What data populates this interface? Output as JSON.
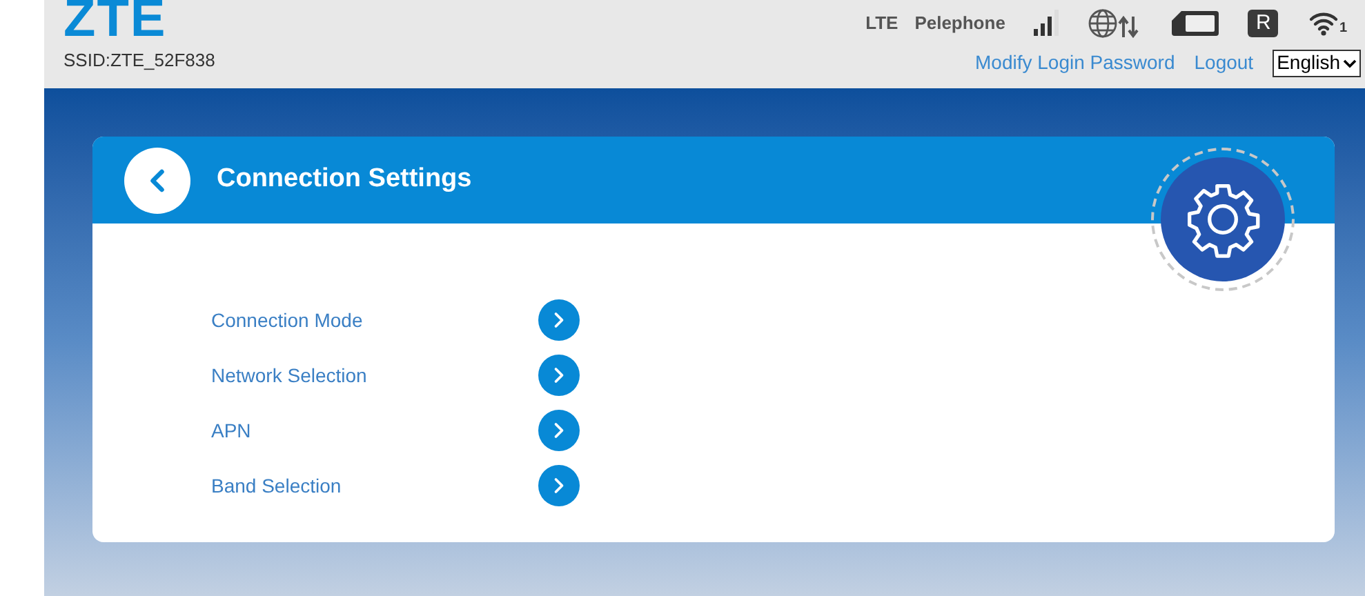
{
  "header": {
    "logo": "ZTE",
    "ssid": "SSID:ZTE_52F838",
    "network_type": "LTE",
    "operator": "Pelephone",
    "roaming": "R",
    "wifi_clients": "1",
    "links": [
      "Modify Login Password",
      "Logout"
    ],
    "language": "English"
  },
  "panel": {
    "title": "Connection Settings",
    "items": [
      {
        "label": "Connection Mode"
      },
      {
        "label": "Network Selection"
      },
      {
        "label": "APN"
      },
      {
        "label": "Band Selection"
      }
    ]
  }
}
